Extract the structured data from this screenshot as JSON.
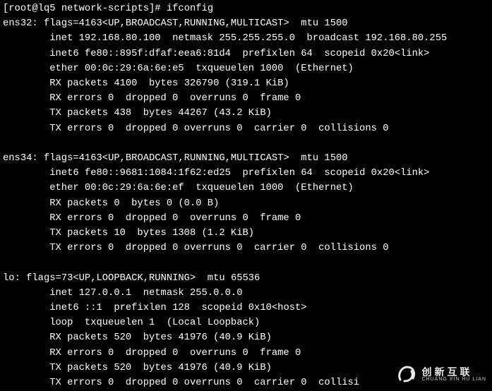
{
  "prompt": {
    "user": "root",
    "host": "lq5",
    "cwd": "network-scripts",
    "symbol": "#",
    "command": "ifconfig"
  },
  "interfaces": [
    {
      "name": "ens32",
      "flags_num": "4163",
      "flags_list": "UP,BROADCAST,RUNNING,MULTICAST",
      "mtu": "1500",
      "inet": "192.168.80.100",
      "netmask": "255.255.255.0",
      "broadcast": "192.168.80.255",
      "inet6": "fe80::895f:dfaf:eea6:81d4",
      "prefixlen": "64",
      "scopeid": "0x20<link>",
      "ether": "00:0c:29:6a:6e:e5",
      "txqueuelen": "1000",
      "link_type": "(Ethernet)",
      "rx_packets": "4100",
      "rx_bytes": "326790",
      "rx_bytes_h": "(319.1 KiB)",
      "rx_errors": "0",
      "rx_dropped": "0",
      "rx_overruns": "0",
      "rx_frame": "0",
      "tx_packets": "438",
      "tx_bytes": "44267",
      "tx_bytes_h": "(43.2 KiB)",
      "tx_errors": "0",
      "tx_dropped": "0",
      "tx_overruns": "0",
      "tx_carrier": "0",
      "tx_collisions": "0"
    },
    {
      "name": "ens34",
      "flags_num": "4163",
      "flags_list": "UP,BROADCAST,RUNNING,MULTICAST",
      "mtu": "1500",
      "inet6": "fe80::9681:1084:1f62:ed25",
      "prefixlen": "64",
      "scopeid": "0x20<link>",
      "ether": "00:0c:29:6a:6e:ef",
      "txqueuelen": "1000",
      "link_type": "(Ethernet)",
      "rx_packets": "0",
      "rx_bytes": "0",
      "rx_bytes_h": "(0.0 B)",
      "rx_errors": "0",
      "rx_dropped": "0",
      "rx_overruns": "0",
      "rx_frame": "0",
      "tx_packets": "10",
      "tx_bytes": "1308",
      "tx_bytes_h": "(1.2 KiB)",
      "tx_errors": "0",
      "tx_dropped": "0",
      "tx_overruns": "0",
      "tx_carrier": "0",
      "tx_collisions": "0"
    },
    {
      "name": "lo",
      "flags_num": "73",
      "flags_list": "UP,LOOPBACK,RUNNING",
      "mtu": "65536",
      "inet": "127.0.0.1",
      "netmask": "255.0.0.0",
      "inet6": "::1",
      "prefixlen": "128",
      "scopeid": "0x10<host>",
      "loop": "loop",
      "txqueuelen": "1",
      "link_type": "(Local Loopback)",
      "rx_packets": "520",
      "rx_bytes": "41976",
      "rx_bytes_h": "(40.9 KiB)",
      "rx_errors": "0",
      "rx_dropped": "0",
      "rx_overruns": "0",
      "rx_frame": "0",
      "tx_packets": "520",
      "tx_bytes": "41976",
      "tx_bytes_h": "(40.9 KiB)",
      "tx_errors": "0",
      "tx_dropped": "0",
      "tx_overruns": "0",
      "tx_carrier": "0",
      "tx_collisions_trunc": "collisi"
    }
  ],
  "watermark": {
    "cn": "创新互联",
    "en": "CHUANG XIN HU LIAN"
  }
}
